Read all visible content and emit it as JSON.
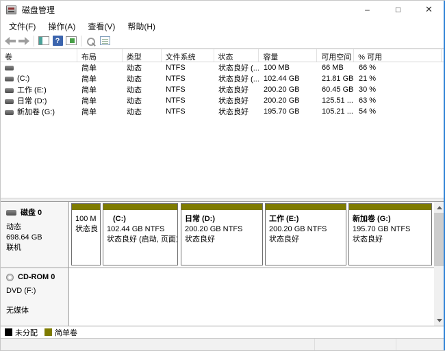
{
  "window": {
    "title": "磁盘管理",
    "controls": {
      "minimize": "–",
      "maximize": "□",
      "close": "✕"
    }
  },
  "menu": {
    "file": "文件(F)",
    "action": "操作(A)",
    "view": "查看(V)",
    "help": "帮助(H)"
  },
  "toolbar": {
    "help_glyph": "?"
  },
  "volume_table": {
    "headers": {
      "volume": "卷",
      "layout": "布局",
      "type": "类型",
      "fs": "文件系统",
      "status": "状态",
      "capacity": "容量",
      "free": "可用空间",
      "pct_free": "% 可用"
    },
    "rows": [
      {
        "volume": "",
        "layout": "简单",
        "type": "动态",
        "fs": "NTFS",
        "status": "状态良好 (...",
        "capacity": "100 MB",
        "free": "66 MB",
        "pct": "66 %"
      },
      {
        "volume": "(C:)",
        "layout": "简单",
        "type": "动态",
        "fs": "NTFS",
        "status": "状态良好 (...",
        "capacity": "102.44 GB",
        "free": "21.81 GB",
        "pct": "21 %"
      },
      {
        "volume": "工作 (E:)",
        "layout": "简单",
        "type": "动态",
        "fs": "NTFS",
        "status": "状态良好",
        "capacity": "200.20 GB",
        "free": "60.45 GB",
        "pct": "30 %"
      },
      {
        "volume": "日常 (D:)",
        "layout": "简单",
        "type": "动态",
        "fs": "NTFS",
        "status": "状态良好",
        "capacity": "200.20 GB",
        "free": "125.51 ...",
        "pct": "63 %"
      },
      {
        "volume": "新加卷 (G:)",
        "layout": "简单",
        "type": "动态",
        "fs": "NTFS",
        "status": "状态良好",
        "capacity": "195.70 GB",
        "free": "105.21 ...",
        "pct": "54 %"
      }
    ]
  },
  "disk0": {
    "name": "磁盘 0",
    "type": "动态",
    "size": "698.64 GB",
    "status": "联机",
    "partitions": [
      {
        "name": "",
        "size": "100 M",
        "status": "状态良"
      },
      {
        "name": "(C:)",
        "size": "102.44 GB NTFS",
        "status": "状态良好 (启动, 页面文"
      },
      {
        "name": "日常  (D:)",
        "size": "200.20 GB NTFS",
        "status": "状态良好"
      },
      {
        "name": "工作  (E:)",
        "size": "200.20 GB NTFS",
        "status": "状态良好"
      },
      {
        "name": "新加卷  (G:)",
        "size": "195.70 GB NTFS",
        "status": "状态良好"
      }
    ]
  },
  "cdrom": {
    "name": "CD-ROM 0",
    "drive": "DVD (F:)",
    "media": "无媒体"
  },
  "legend": {
    "unallocated": "未分配",
    "simple_volume": "简单卷"
  },
  "colors": {
    "simple_volume": "#7e7b00",
    "unallocated": "#000000",
    "accent_edge": "#2f82d6"
  }
}
